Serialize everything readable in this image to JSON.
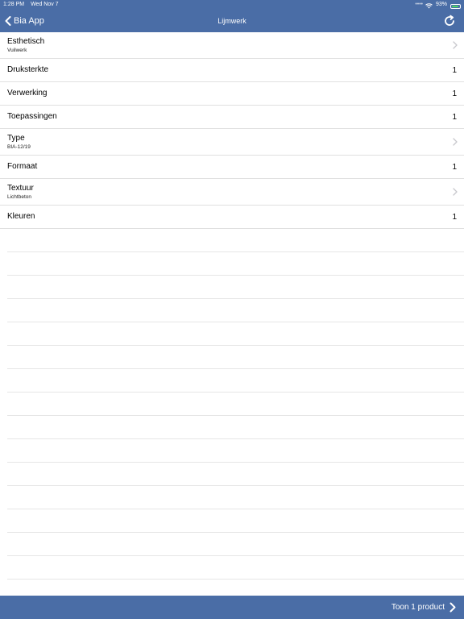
{
  "status_bar": {
    "time": "1:28 PM",
    "date": "Wed Nov 7",
    "battery": "93%",
    "battery_level": 0.93,
    "icons": [
      "wifi-icon",
      "battery-icon"
    ]
  },
  "nav": {
    "back_label": "Bia App",
    "title": "Lijmwerk",
    "icons": [
      "chevron-left-icon",
      "refresh-icon"
    ]
  },
  "filters": [
    {
      "title": "Esthetisch",
      "subtitle": "Vuilwerk",
      "count": null,
      "chevron": true
    },
    {
      "title": "Druksterkte",
      "subtitle": null,
      "count": "1",
      "chevron": false
    },
    {
      "title": "Verwerking",
      "subtitle": null,
      "count": "1",
      "chevron": false
    },
    {
      "title": "Toepassingen",
      "subtitle": null,
      "count": "1",
      "chevron": false
    },
    {
      "title": "Type",
      "subtitle": "BIA-12/19",
      "count": null,
      "chevron": true
    },
    {
      "title": "Formaat",
      "subtitle": null,
      "count": "1",
      "chevron": false
    },
    {
      "title": "Textuur",
      "subtitle": "Lichtbeton",
      "count": null,
      "chevron": true
    },
    {
      "title": "Kleuren",
      "subtitle": null,
      "count": "1",
      "chevron": false
    }
  ],
  "footer": {
    "show_label": "Toon 1 product",
    "icon": "chevron-right-icon"
  },
  "colors": {
    "bar": "#4a6da6",
    "separator": "#e0e0e0",
    "chevron": "#c7c7cc"
  }
}
